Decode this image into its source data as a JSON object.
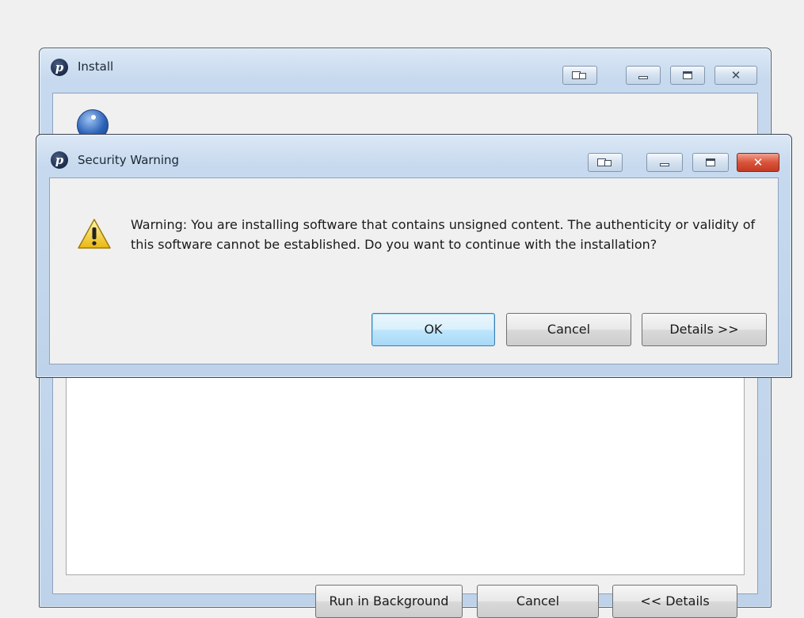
{
  "install_window": {
    "title": "Install",
    "buttons": {
      "run_background": "Run in Background",
      "cancel": "Cancel",
      "details": "<< Details"
    }
  },
  "warning_dialog": {
    "title": "Security Warning",
    "message": "Warning: You are installing software that contains unsigned content. The authenticity or validity of this software cannot be established. Do you want to continue with the installation?",
    "buttons": {
      "ok": "OK",
      "cancel": "Cancel",
      "details": "Details >>"
    }
  },
  "icons": {
    "app": "p-logo-icon",
    "info": "info-icon",
    "warning": "warning-triangle-icon"
  },
  "colors": {
    "title_bar": "#c7d9ee",
    "close_button": "#d9533a",
    "default_button_border": "#3c7fb1"
  }
}
